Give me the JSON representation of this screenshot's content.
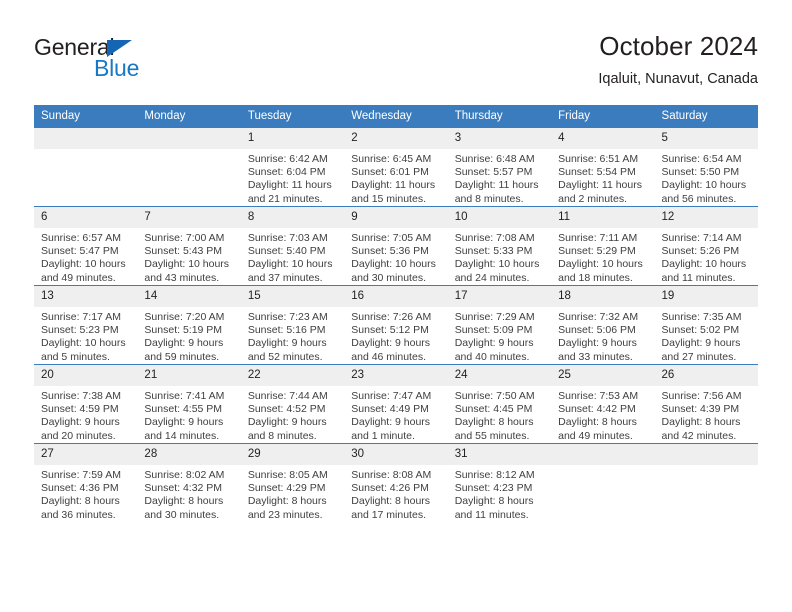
{
  "brand": {
    "name_part1": "General",
    "name_part2": "Blue",
    "triangle_color": "#1565b5",
    "blue_color": "#1778c4"
  },
  "header": {
    "month_title": "October 2024",
    "location": "Iqaluit, Nunavut, Canada"
  },
  "calendar": {
    "header_bg": "#3a7cbe",
    "daynum_bg": "#efefef",
    "weekday_headers": [
      "Sunday",
      "Monday",
      "Tuesday",
      "Wednesday",
      "Thursday",
      "Friday",
      "Saturday"
    ],
    "weeks": [
      [
        {
          "day": "",
          "detail": ""
        },
        {
          "day": "",
          "detail": ""
        },
        {
          "day": "1",
          "detail": "Sunrise: 6:42 AM\nSunset: 6:04 PM\nDaylight: 11 hours\nand 21 minutes."
        },
        {
          "day": "2",
          "detail": "Sunrise: 6:45 AM\nSunset: 6:01 PM\nDaylight: 11 hours\nand 15 minutes."
        },
        {
          "day": "3",
          "detail": "Sunrise: 6:48 AM\nSunset: 5:57 PM\nDaylight: 11 hours\nand 8 minutes."
        },
        {
          "day": "4",
          "detail": "Sunrise: 6:51 AM\nSunset: 5:54 PM\nDaylight: 11 hours\nand 2 minutes."
        },
        {
          "day": "5",
          "detail": "Sunrise: 6:54 AM\nSunset: 5:50 PM\nDaylight: 10 hours\nand 56 minutes."
        }
      ],
      [
        {
          "day": "6",
          "detail": "Sunrise: 6:57 AM\nSunset: 5:47 PM\nDaylight: 10 hours\nand 49 minutes."
        },
        {
          "day": "7",
          "detail": "Sunrise: 7:00 AM\nSunset: 5:43 PM\nDaylight: 10 hours\nand 43 minutes."
        },
        {
          "day": "8",
          "detail": "Sunrise: 7:03 AM\nSunset: 5:40 PM\nDaylight: 10 hours\nand 37 minutes."
        },
        {
          "day": "9",
          "detail": "Sunrise: 7:05 AM\nSunset: 5:36 PM\nDaylight: 10 hours\nand 30 minutes."
        },
        {
          "day": "10",
          "detail": "Sunrise: 7:08 AM\nSunset: 5:33 PM\nDaylight: 10 hours\nand 24 minutes."
        },
        {
          "day": "11",
          "detail": "Sunrise: 7:11 AM\nSunset: 5:29 PM\nDaylight: 10 hours\nand 18 minutes."
        },
        {
          "day": "12",
          "detail": "Sunrise: 7:14 AM\nSunset: 5:26 PM\nDaylight: 10 hours\nand 11 minutes."
        }
      ],
      [
        {
          "day": "13",
          "detail": "Sunrise: 7:17 AM\nSunset: 5:23 PM\nDaylight: 10 hours\nand 5 minutes."
        },
        {
          "day": "14",
          "detail": "Sunrise: 7:20 AM\nSunset: 5:19 PM\nDaylight: 9 hours\nand 59 minutes."
        },
        {
          "day": "15",
          "detail": "Sunrise: 7:23 AM\nSunset: 5:16 PM\nDaylight: 9 hours\nand 52 minutes."
        },
        {
          "day": "16",
          "detail": "Sunrise: 7:26 AM\nSunset: 5:12 PM\nDaylight: 9 hours\nand 46 minutes."
        },
        {
          "day": "17",
          "detail": "Sunrise: 7:29 AM\nSunset: 5:09 PM\nDaylight: 9 hours\nand 40 minutes."
        },
        {
          "day": "18",
          "detail": "Sunrise: 7:32 AM\nSunset: 5:06 PM\nDaylight: 9 hours\nand 33 minutes."
        },
        {
          "day": "19",
          "detail": "Sunrise: 7:35 AM\nSunset: 5:02 PM\nDaylight: 9 hours\nand 27 minutes."
        }
      ],
      [
        {
          "day": "20",
          "detail": "Sunrise: 7:38 AM\nSunset: 4:59 PM\nDaylight: 9 hours\nand 20 minutes."
        },
        {
          "day": "21",
          "detail": "Sunrise: 7:41 AM\nSunset: 4:55 PM\nDaylight: 9 hours\nand 14 minutes."
        },
        {
          "day": "22",
          "detail": "Sunrise: 7:44 AM\nSunset: 4:52 PM\nDaylight: 9 hours\nand 8 minutes."
        },
        {
          "day": "23",
          "detail": "Sunrise: 7:47 AM\nSunset: 4:49 PM\nDaylight: 9 hours\nand 1 minute."
        },
        {
          "day": "24",
          "detail": "Sunrise: 7:50 AM\nSunset: 4:45 PM\nDaylight: 8 hours\nand 55 minutes."
        },
        {
          "day": "25",
          "detail": "Sunrise: 7:53 AM\nSunset: 4:42 PM\nDaylight: 8 hours\nand 49 minutes."
        },
        {
          "day": "26",
          "detail": "Sunrise: 7:56 AM\nSunset: 4:39 PM\nDaylight: 8 hours\nand 42 minutes."
        }
      ],
      [
        {
          "day": "27",
          "detail": "Sunrise: 7:59 AM\nSunset: 4:36 PM\nDaylight: 8 hours\nand 36 minutes."
        },
        {
          "day": "28",
          "detail": "Sunrise: 8:02 AM\nSunset: 4:32 PM\nDaylight: 8 hours\nand 30 minutes."
        },
        {
          "day": "29",
          "detail": "Sunrise: 8:05 AM\nSunset: 4:29 PM\nDaylight: 8 hours\nand 23 minutes."
        },
        {
          "day": "30",
          "detail": "Sunrise: 8:08 AM\nSunset: 4:26 PM\nDaylight: 8 hours\nand 17 minutes."
        },
        {
          "day": "31",
          "detail": "Sunrise: 8:12 AM\nSunset: 4:23 PM\nDaylight: 8 hours\nand 11 minutes."
        },
        {
          "day": "",
          "detail": ""
        },
        {
          "day": "",
          "detail": ""
        }
      ]
    ]
  }
}
